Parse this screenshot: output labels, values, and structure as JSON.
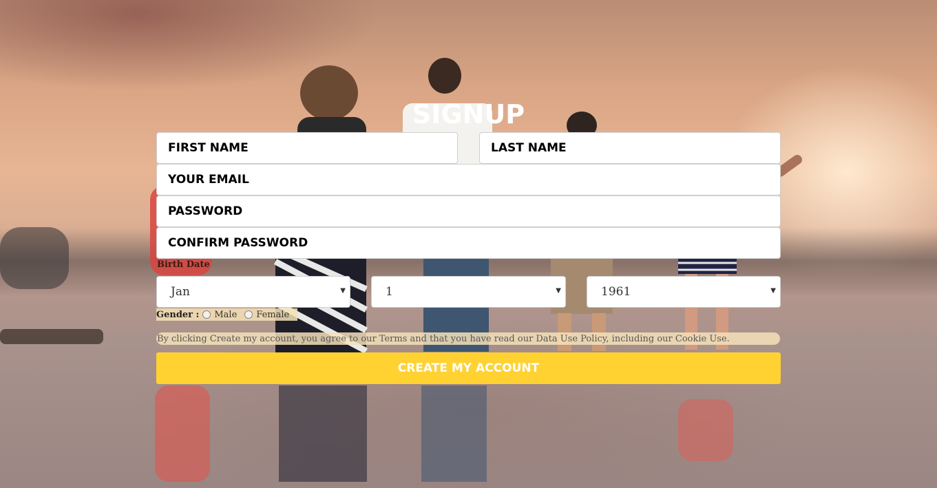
{
  "page": {
    "title": "SIGNUP"
  },
  "form": {
    "first_name_placeholder": "FIRST NAME",
    "last_name_placeholder": "LAST NAME",
    "email_placeholder": "YOUR EMAIL",
    "password_placeholder": "PASSWORD",
    "confirm_password_placeholder": "CONFIRM PASSWORD",
    "birth_date_label": "Birth Date",
    "birth_month": "Jan",
    "birth_day": "1",
    "birth_year": "1961",
    "gender_label": "Gender :",
    "gender_options": [
      "Male",
      "Female"
    ],
    "terms_text": "By clicking Create my account, you agree to our Terms and that you have read our Data Use Policy, including our Cookie Use.",
    "submit_label": "CREATE MY ACCOUNT"
  },
  "colors": {
    "accent": "#ffd232",
    "field_background": "#ffffff",
    "title_color": "#ffffff"
  },
  "icons": {
    "select_caret": "caret-down-icon",
    "radio": "radio-icon"
  }
}
